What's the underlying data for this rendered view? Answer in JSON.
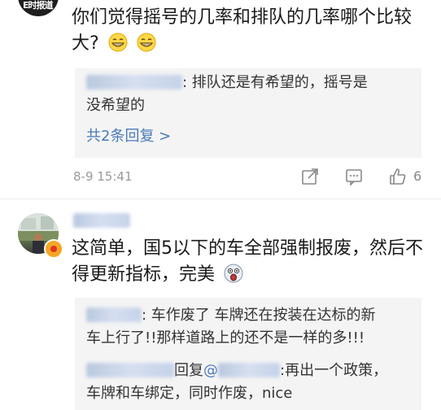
{
  "comment1": {
    "avatar_text": "E时报道",
    "text": "你们觉得摇号的几率和排队的几率哪个比较大?",
    "emojis": [
      "grin-emoji",
      "grin-emoji"
    ],
    "reply_preview": {
      "line1": ": 排队还是有希望的，摇号是",
      "line2": "没希望的"
    },
    "more_replies": "共2条回复 >",
    "timestamp": "8-9 15:41",
    "like_count": "6"
  },
  "comment2": {
    "text": "这简单，国5以下的车全部强制报废，然后不得更新指标，完美",
    "emojis": [
      "shocked-emoji"
    ],
    "reply1": {
      "line1": ": 车作废了 车牌还在按装在达标的新",
      "line2": "车上行了!!那样道路上的还不是一样的多!!!"
    },
    "reply2": {
      "reply_word": "回复",
      "at_sign": "@",
      "line1_rest": ":再出一个政策，",
      "line2": "车牌和车绑定，同时作废，nice"
    }
  },
  "colors": {
    "link": "#4a7ab8",
    "reply_bg": "#f4f4f4",
    "meta": "#9a9a9a"
  }
}
